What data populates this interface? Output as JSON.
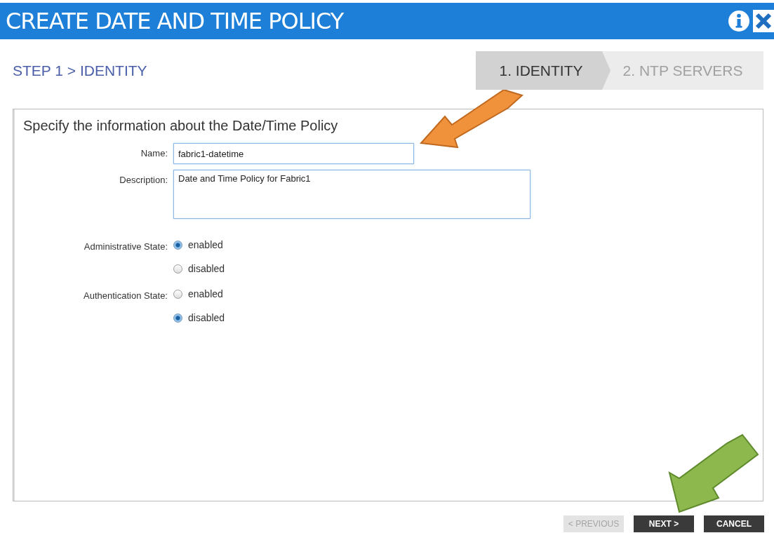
{
  "window": {
    "title": "CREATE DATE AND TIME POLICY"
  },
  "step_label": "STEP 1 > IDENTITY",
  "steps": [
    {
      "label": "1. IDENTITY",
      "selected": true
    },
    {
      "label": "2. NTP SERVERS",
      "selected": false
    }
  ],
  "form": {
    "heading": "Specify the information about the Date/Time Policy",
    "name": {
      "label": "Name:",
      "value": "fabric1-datetime"
    },
    "description": {
      "label": "Description:",
      "value": "Date and Time Policy for Fabric1"
    },
    "radio_groups": [
      {
        "label": "Administrative State:",
        "options": [
          {
            "label": "enabled",
            "selected": true
          },
          {
            "label": "disabled",
            "selected": false
          }
        ]
      },
      {
        "label": "Authentication State:",
        "options": [
          {
            "label": "enabled",
            "selected": false
          },
          {
            "label": "disabled",
            "selected": true
          }
        ]
      }
    ]
  },
  "buttons": [
    {
      "label": "< PREVIOUS",
      "disabled": true
    },
    {
      "label": "NEXT >",
      "disabled": false
    },
    {
      "label": "CANCEL",
      "disabled": false
    }
  ]
}
